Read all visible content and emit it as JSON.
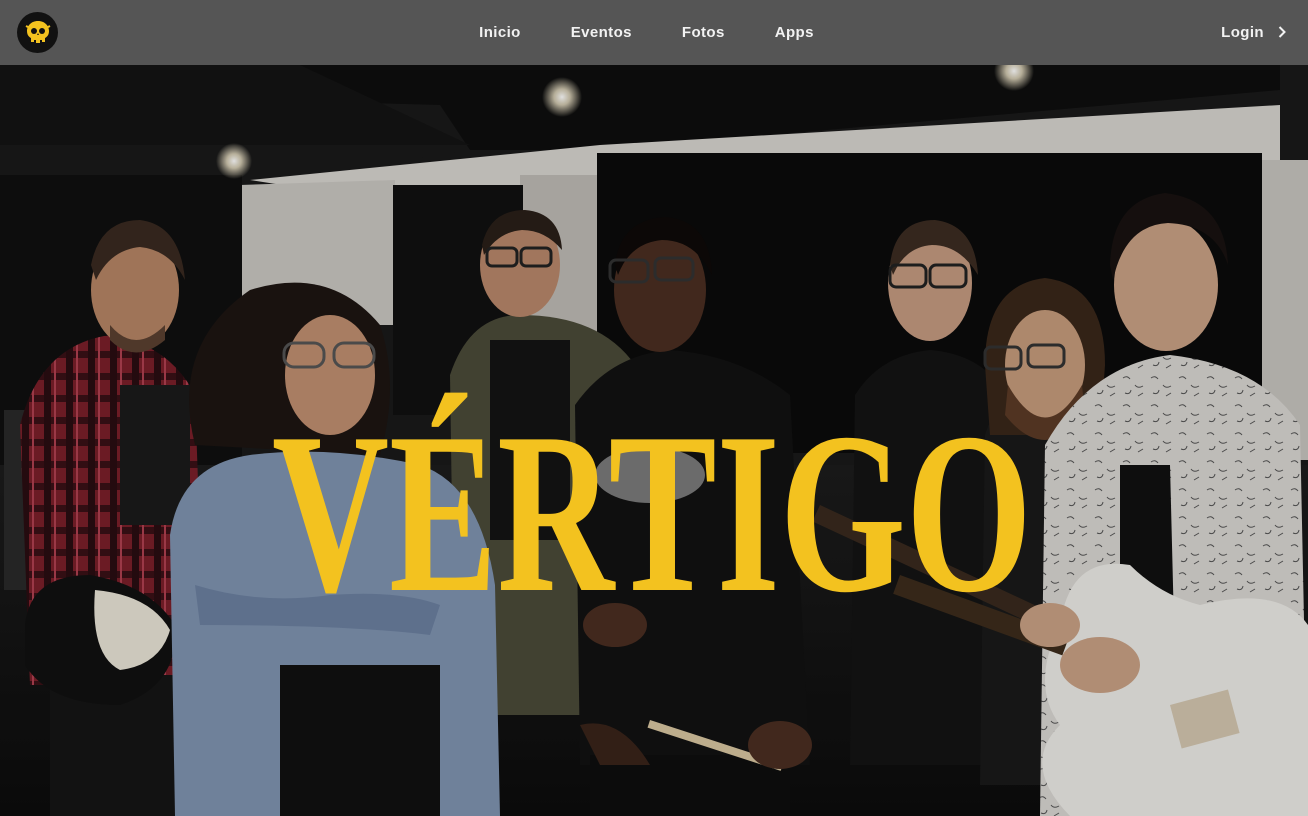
{
  "nav": {
    "links": [
      {
        "label": "Inicio"
      },
      {
        "label": "Eventos"
      },
      {
        "label": "Fotos"
      },
      {
        "label": "Apps"
      }
    ],
    "login_label": "Login",
    "login_icon": "chevron-right-icon",
    "logo_icon": "skull-icon"
  },
  "hero": {
    "band_name": "VÉRTIGO",
    "photo_description_icon": "band-photo",
    "accent_color": "#f3c21f",
    "navbar_color": "#555555"
  }
}
